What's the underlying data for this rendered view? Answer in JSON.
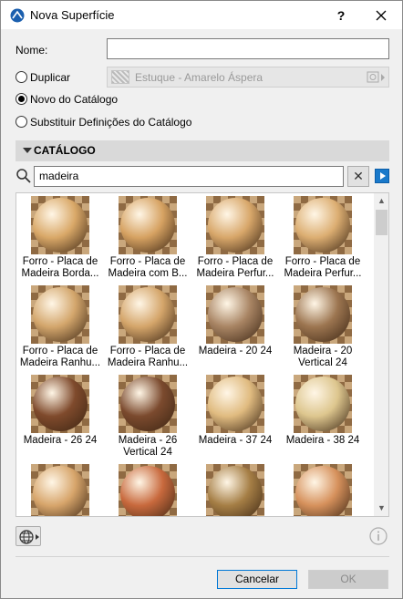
{
  "window": {
    "title": "Nova Superfície",
    "help_label": "?",
    "close_icon": "close-icon"
  },
  "form": {
    "name_label": "Nome:",
    "name_value": "",
    "duplicate_label": "Duplicar",
    "duplicate_value": "Estuque - Amarelo Áspera",
    "new_from_catalog_label": "Novo do Catálogo",
    "replace_label": "Substituir Definições do Catálogo",
    "selected_option": "Novo do Catálogo"
  },
  "catalog": {
    "section_title": "CATÁLOGO",
    "search_value": "madeira",
    "clear_label": "✕",
    "items": [
      {
        "caption": "Forro - Placa de Madeira Borda...",
        "color": "#d9a868"
      },
      {
        "caption": "Forro - Placa de Madeira com B...",
        "color": "#d6a262"
      },
      {
        "caption": "Forro - Placa de Madeira Perfur...",
        "color": "#d8a76a"
      },
      {
        "caption": "Forro - Placa de Madeira Perfur...",
        "color": "#dcae72"
      },
      {
        "caption": "Forro - Placa de Madeira Ranhu...",
        "color": "#d3a66c"
      },
      {
        "caption": "Forro - Placa de Madeira Ranhu...",
        "color": "#d4a56a"
      },
      {
        "caption": "Madeira - 20 24",
        "color": "#a88463"
      },
      {
        "caption": "Madeira - 20 Vertical 24",
        "color": "#9c7550"
      },
      {
        "caption": "Madeira - 26 24",
        "color": "#7f4a2c"
      },
      {
        "caption": "Madeira - 26 Vertical 24",
        "color": "#7b4a2e"
      },
      {
        "caption": "Madeira - 37 24",
        "color": "#e0bb80"
      },
      {
        "caption": "Madeira - 38 24",
        "color": "#ddc68e"
      },
      {
        "caption": "",
        "color": "#d7a56b"
      },
      {
        "caption": "",
        "color": "#c8693d"
      },
      {
        "caption": "",
        "color": "#a57e45"
      },
      {
        "caption": "",
        "color": "#d6915c"
      }
    ]
  },
  "footer": {
    "cancel_label": "Cancelar",
    "ok_label": "OK"
  }
}
